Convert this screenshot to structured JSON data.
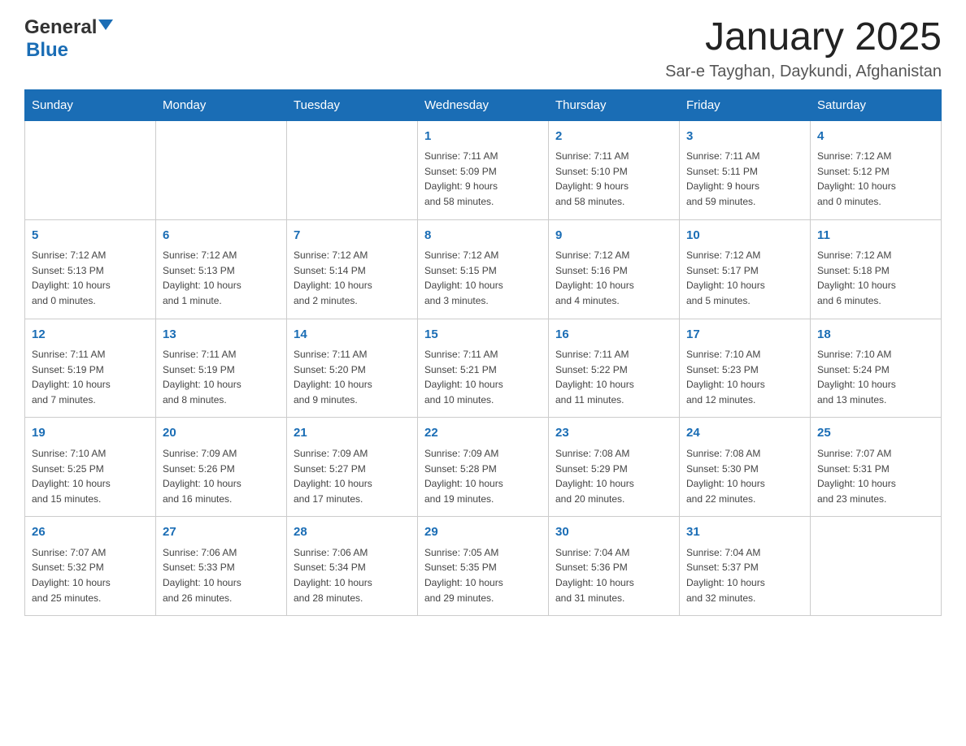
{
  "header": {
    "logo": {
      "general_text": "General",
      "blue_text": "Blue"
    },
    "title": "January 2025",
    "location": "Sar-e Tayghan, Daykundi, Afghanistan"
  },
  "calendar": {
    "days_of_week": [
      "Sunday",
      "Monday",
      "Tuesday",
      "Wednesday",
      "Thursday",
      "Friday",
      "Saturday"
    ],
    "weeks": [
      [
        {
          "day": "",
          "info": ""
        },
        {
          "day": "",
          "info": ""
        },
        {
          "day": "",
          "info": ""
        },
        {
          "day": "1",
          "info": "Sunrise: 7:11 AM\nSunset: 5:09 PM\nDaylight: 9 hours\nand 58 minutes."
        },
        {
          "day": "2",
          "info": "Sunrise: 7:11 AM\nSunset: 5:10 PM\nDaylight: 9 hours\nand 58 minutes."
        },
        {
          "day": "3",
          "info": "Sunrise: 7:11 AM\nSunset: 5:11 PM\nDaylight: 9 hours\nand 59 minutes."
        },
        {
          "day": "4",
          "info": "Sunrise: 7:12 AM\nSunset: 5:12 PM\nDaylight: 10 hours\nand 0 minutes."
        }
      ],
      [
        {
          "day": "5",
          "info": "Sunrise: 7:12 AM\nSunset: 5:13 PM\nDaylight: 10 hours\nand 0 minutes."
        },
        {
          "day": "6",
          "info": "Sunrise: 7:12 AM\nSunset: 5:13 PM\nDaylight: 10 hours\nand 1 minute."
        },
        {
          "day": "7",
          "info": "Sunrise: 7:12 AM\nSunset: 5:14 PM\nDaylight: 10 hours\nand 2 minutes."
        },
        {
          "day": "8",
          "info": "Sunrise: 7:12 AM\nSunset: 5:15 PM\nDaylight: 10 hours\nand 3 minutes."
        },
        {
          "day": "9",
          "info": "Sunrise: 7:12 AM\nSunset: 5:16 PM\nDaylight: 10 hours\nand 4 minutes."
        },
        {
          "day": "10",
          "info": "Sunrise: 7:12 AM\nSunset: 5:17 PM\nDaylight: 10 hours\nand 5 minutes."
        },
        {
          "day": "11",
          "info": "Sunrise: 7:12 AM\nSunset: 5:18 PM\nDaylight: 10 hours\nand 6 minutes."
        }
      ],
      [
        {
          "day": "12",
          "info": "Sunrise: 7:11 AM\nSunset: 5:19 PM\nDaylight: 10 hours\nand 7 minutes."
        },
        {
          "day": "13",
          "info": "Sunrise: 7:11 AM\nSunset: 5:19 PM\nDaylight: 10 hours\nand 8 minutes."
        },
        {
          "day": "14",
          "info": "Sunrise: 7:11 AM\nSunset: 5:20 PM\nDaylight: 10 hours\nand 9 minutes."
        },
        {
          "day": "15",
          "info": "Sunrise: 7:11 AM\nSunset: 5:21 PM\nDaylight: 10 hours\nand 10 minutes."
        },
        {
          "day": "16",
          "info": "Sunrise: 7:11 AM\nSunset: 5:22 PM\nDaylight: 10 hours\nand 11 minutes."
        },
        {
          "day": "17",
          "info": "Sunrise: 7:10 AM\nSunset: 5:23 PM\nDaylight: 10 hours\nand 12 minutes."
        },
        {
          "day": "18",
          "info": "Sunrise: 7:10 AM\nSunset: 5:24 PM\nDaylight: 10 hours\nand 13 minutes."
        }
      ],
      [
        {
          "day": "19",
          "info": "Sunrise: 7:10 AM\nSunset: 5:25 PM\nDaylight: 10 hours\nand 15 minutes."
        },
        {
          "day": "20",
          "info": "Sunrise: 7:09 AM\nSunset: 5:26 PM\nDaylight: 10 hours\nand 16 minutes."
        },
        {
          "day": "21",
          "info": "Sunrise: 7:09 AM\nSunset: 5:27 PM\nDaylight: 10 hours\nand 17 minutes."
        },
        {
          "day": "22",
          "info": "Sunrise: 7:09 AM\nSunset: 5:28 PM\nDaylight: 10 hours\nand 19 minutes."
        },
        {
          "day": "23",
          "info": "Sunrise: 7:08 AM\nSunset: 5:29 PM\nDaylight: 10 hours\nand 20 minutes."
        },
        {
          "day": "24",
          "info": "Sunrise: 7:08 AM\nSunset: 5:30 PM\nDaylight: 10 hours\nand 22 minutes."
        },
        {
          "day": "25",
          "info": "Sunrise: 7:07 AM\nSunset: 5:31 PM\nDaylight: 10 hours\nand 23 minutes."
        }
      ],
      [
        {
          "day": "26",
          "info": "Sunrise: 7:07 AM\nSunset: 5:32 PM\nDaylight: 10 hours\nand 25 minutes."
        },
        {
          "day": "27",
          "info": "Sunrise: 7:06 AM\nSunset: 5:33 PM\nDaylight: 10 hours\nand 26 minutes."
        },
        {
          "day": "28",
          "info": "Sunrise: 7:06 AM\nSunset: 5:34 PM\nDaylight: 10 hours\nand 28 minutes."
        },
        {
          "day": "29",
          "info": "Sunrise: 7:05 AM\nSunset: 5:35 PM\nDaylight: 10 hours\nand 29 minutes."
        },
        {
          "day": "30",
          "info": "Sunrise: 7:04 AM\nSunset: 5:36 PM\nDaylight: 10 hours\nand 31 minutes."
        },
        {
          "day": "31",
          "info": "Sunrise: 7:04 AM\nSunset: 5:37 PM\nDaylight: 10 hours\nand 32 minutes."
        },
        {
          "day": "",
          "info": ""
        }
      ]
    ]
  }
}
